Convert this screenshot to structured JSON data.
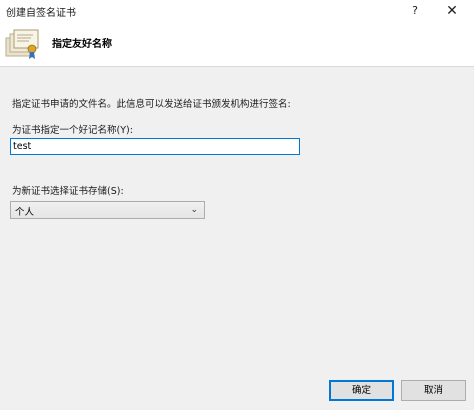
{
  "window": {
    "title": "创建自签名证书",
    "help_glyph": "?",
    "close_glyph": "✕"
  },
  "header": {
    "icon": "certificate-icon",
    "title": "指定友好名称"
  },
  "main": {
    "description": "指定证书申请的文件名。此信息可以发送给证书颁发机构进行签名:",
    "name_label": "为证书指定一个好记名称(Y):",
    "name_value": "test",
    "store_label": "为新证书选择证书存储(S):",
    "store_value": "个人",
    "store_chevron": "⌄"
  },
  "footer": {
    "ok_label": "确定",
    "cancel_label": "取消"
  },
  "colors": {
    "focus_blue": "#0078d7",
    "dialog_bg": "#f0f0f0",
    "header_bg": "#ffffff"
  }
}
